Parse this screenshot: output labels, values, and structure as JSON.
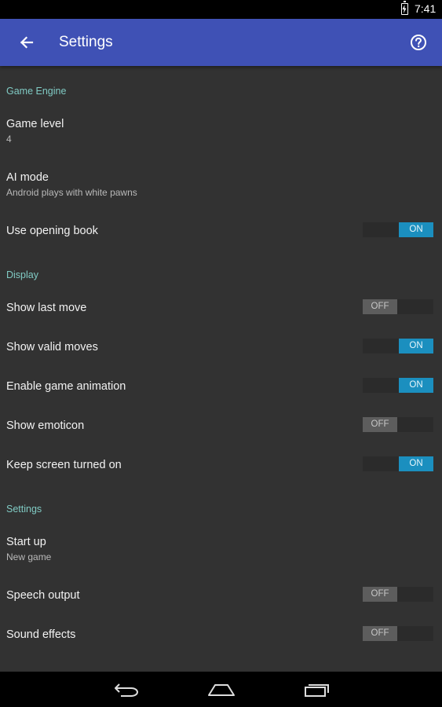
{
  "status_bar": {
    "time": "7:41"
  },
  "app_bar": {
    "title": "Settings"
  },
  "sections": {
    "game_engine": {
      "header": "Game Engine"
    },
    "display": {
      "header": "Display"
    },
    "settings": {
      "header": "Settings"
    }
  },
  "prefs": {
    "game_level": {
      "title": "Game level",
      "summary": "4"
    },
    "ai_mode": {
      "title": "AI mode",
      "summary": "Android plays with white pawns"
    },
    "use_opening_book": {
      "title": "Use opening book",
      "state": "ON",
      "checked": true
    },
    "show_last_move": {
      "title": "Show last move",
      "state": "OFF",
      "checked": false
    },
    "show_valid_moves": {
      "title": "Show valid moves",
      "state": "ON",
      "checked": true
    },
    "enable_game_animation": {
      "title": "Enable game animation",
      "state": "ON",
      "checked": true
    },
    "show_emoticon": {
      "title": "Show emoticon",
      "state": "OFF",
      "checked": false
    },
    "keep_screen_on": {
      "title": "Keep screen turned on",
      "state": "ON",
      "checked": true
    },
    "start_up": {
      "title": "Start up",
      "summary": "New game"
    },
    "speech_output": {
      "title": "Speech output",
      "state": "OFF",
      "checked": false
    },
    "sound_effects": {
      "title": "Sound effects",
      "state": "OFF",
      "checked": false
    }
  },
  "colors": {
    "app_bar": "#3f51b5",
    "background": "#323232",
    "section_header": "#80cbc4",
    "toggle_on": "#1b8fbf",
    "toggle_off": "#5d5d5d"
  },
  "icons": {
    "back": "arrow-back-icon",
    "help": "help-circle-icon",
    "battery": "battery-charging-icon",
    "nav_back": "nav-back-icon",
    "nav_home": "nav-home-icon",
    "nav_recents": "nav-recents-icon"
  }
}
